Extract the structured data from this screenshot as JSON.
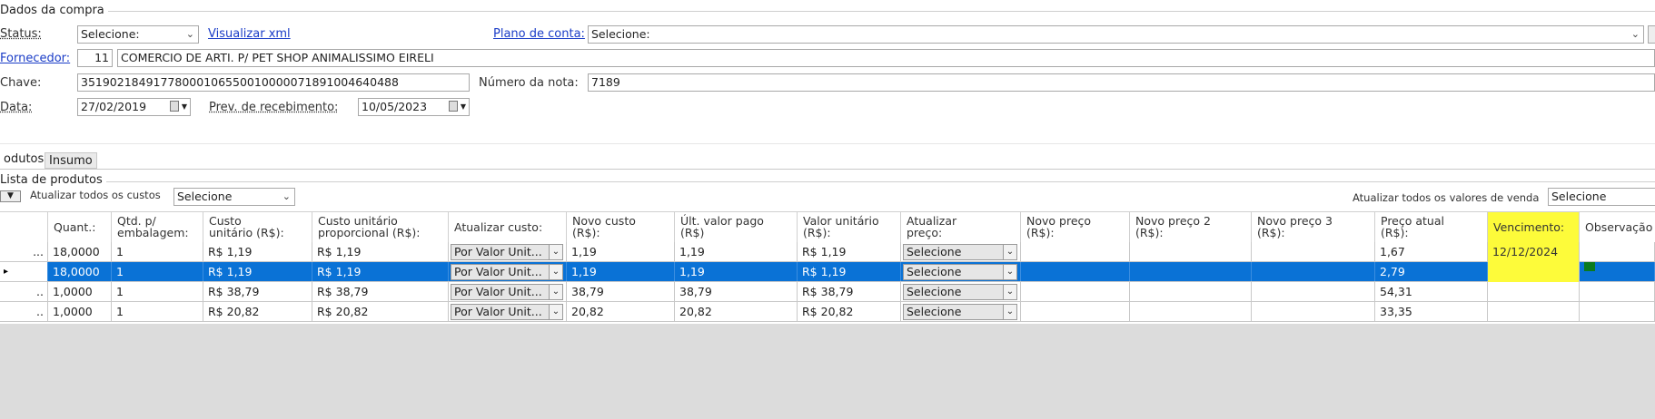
{
  "purchase": {
    "legend": "Dados da compra",
    "status_label": "Status:",
    "status_value": "Selecione:",
    "view_xml_link": "Visualizar xml",
    "account_plan_label": "Plano de conta:",
    "account_plan_value": "Selecione:",
    "supplier_label": "Fornecedor:",
    "supplier_code": "11",
    "supplier_name": "COMERCIO DE ARTI.  P/ PET SHOP ANIMALISSIMO EIRELI",
    "key_label": "Chave:",
    "key_value": "35190218491778000106550010000071891004640488",
    "invoice_number_label": "Número da nota:",
    "invoice_number_value": "7189",
    "date_label": "Data:",
    "date_value": "27/02/2019",
    "expected_receipt_label": "Prev. de recebimento:",
    "expected_receipt_value": "10/05/2023"
  },
  "tabs": [
    {
      "label": "odutos"
    },
    {
      "label": "Insumo"
    }
  ],
  "products": {
    "legend": "Lista de produtos",
    "update_all_costs_label": "Atualizar todos os custos",
    "update_all_costs_value": "Selecione",
    "update_all_sale_values_label": "Atualizar todos os valores de venda",
    "update_all_sale_values_value": "Selecione"
  },
  "grid": {
    "columns": [
      {
        "line1": "Quant.:",
        "line2": ""
      },
      {
        "line1": "Qtd. p/",
        "line2": "embalagem:"
      },
      {
        "line1": "Custo",
        "line2": "unitário (R$):"
      },
      {
        "line1": "Custo unitário",
        "line2": "proporcional (R$):"
      },
      {
        "line1": "Atualizar custo:",
        "line2": ""
      },
      {
        "line1": "Novo custo",
        "line2": "(R$):"
      },
      {
        "line1": "Últ. valor pago",
        "line2": "(R$)"
      },
      {
        "line1": "Valor unitário",
        "line2": "(R$):"
      },
      {
        "line1": "Atualizar",
        "line2": "preço:"
      },
      {
        "line1": "Novo preço",
        "line2": "(R$):"
      },
      {
        "line1": "Novo preço 2",
        "line2": "(R$):"
      },
      {
        "line1": "Novo preço 3",
        "line2": "(R$):"
      },
      {
        "line1": "Preço atual",
        "line2": "(R$):"
      },
      {
        "line1": "Vencimento:",
        "line2": ""
      },
      {
        "line1": "Observação",
        "line2": ""
      }
    ],
    "rows": [
      {
        "ind": "...",
        "qty": "18,0000",
        "pack": "1",
        "unit_cost": "R$ 1,19",
        "prop_cost": "R$ 1,19",
        "update_cost": "Por Valor Unit...",
        "new_cost": "1,19",
        "last_paid": "1,19",
        "unit_value": "R$ 1,19",
        "update_price": "Selecione",
        "new_price": "",
        "new_price2": "",
        "new_price3": "",
        "current_price": "1,67",
        "due": "12/12/2024",
        "obs": ""
      },
      {
        "ind": "...",
        "qty": "18,0000",
        "pack": "1",
        "unit_cost": "R$ 1,19",
        "prop_cost": "R$ 1,19",
        "update_cost": "Por Valor Unit...",
        "new_cost": "1,19",
        "last_paid": "1,19",
        "unit_value": "R$ 1,19",
        "update_price": "Selecione",
        "new_price": "",
        "new_price2": "",
        "new_price3": "",
        "current_price": "2,79",
        "due": "",
        "obs": ""
      },
      {
        "ind": "..",
        "qty": "1,0000",
        "pack": "1",
        "unit_cost": "R$ 38,79",
        "prop_cost": "R$ 38,79",
        "update_cost": "Por Valor Unit...",
        "new_cost": "38,79",
        "last_paid": "38,79",
        "unit_value": "R$ 38,79",
        "update_price": "Selecione",
        "new_price": "",
        "new_price2": "",
        "new_price3": "",
        "current_price": "54,31",
        "due": "",
        "obs": ""
      },
      {
        "ind": "..",
        "qty": "1,0000",
        "pack": "1",
        "unit_cost": "R$ 20,82",
        "prop_cost": "R$ 20,82",
        "update_cost": "Por Valor Unit...",
        "new_cost": "20,82",
        "last_paid": "20,82",
        "unit_value": "R$ 20,82",
        "update_price": "Selecione",
        "new_price": "",
        "new_price2": "",
        "new_price3": "",
        "current_price": "33,35",
        "due": "",
        "obs": ""
      }
    ]
  },
  "colors": {
    "selected_row": "#0a72d6",
    "highlight": "#fdfb3a",
    "link": "#1a3cc7"
  }
}
